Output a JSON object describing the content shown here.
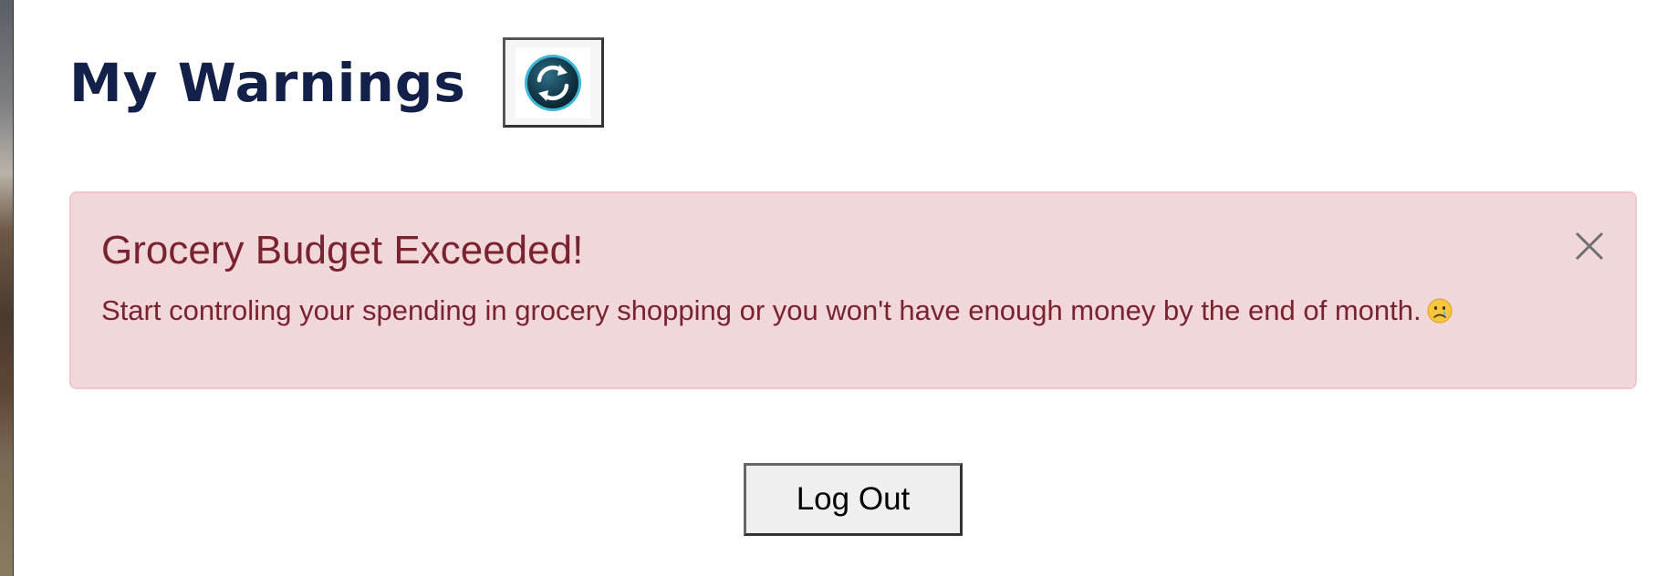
{
  "header": {
    "title": "My Warnings",
    "refresh_icon": "refresh-icon"
  },
  "alert": {
    "heading": "Grocery Budget Exceeded!",
    "message": "Start controling your spending in grocery shopping or you won't have enough money by the end of month.",
    "emoji_icon": "crying-face-icon",
    "close_icon": "close-icon",
    "colors": {
      "background": "#f2d7da",
      "border": "#f0c5cb",
      "text": "#7a2330"
    }
  },
  "footer": {
    "logout_label": "Log Out"
  }
}
